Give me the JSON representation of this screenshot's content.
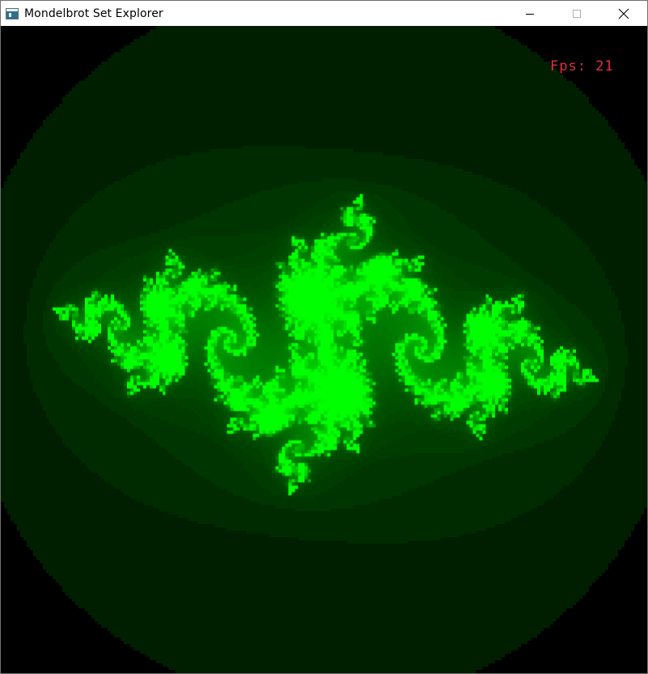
{
  "window": {
    "title": "Mondelbrot Set Explorer",
    "app_icon": "window-app-icon",
    "controls": {
      "minimize_icon": "minimize-icon",
      "maximize_icon": "maximize-icon",
      "close_icon": "close-icon"
    }
  },
  "overlay": {
    "fps_label": "Fps: 21",
    "fps_color": "#e0303c"
  },
  "fractal": {
    "type": "julia-set",
    "color": "#00ff00",
    "background": "#000000"
  }
}
